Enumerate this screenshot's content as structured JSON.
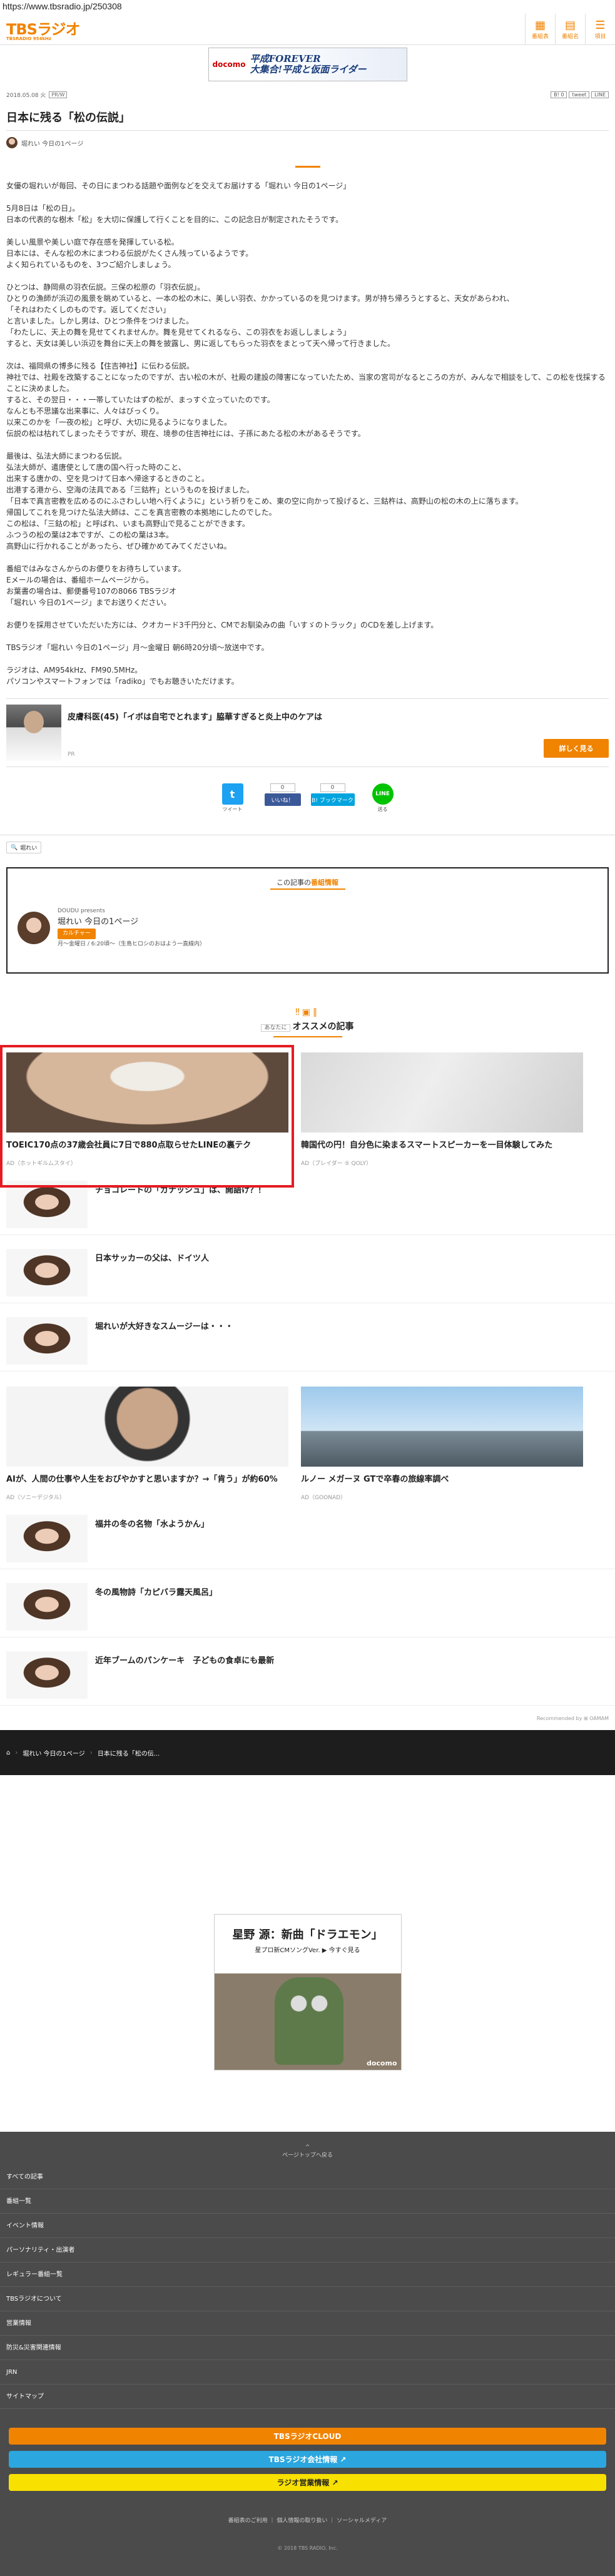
{
  "url": "https://www.tbsradio.jp/250308",
  "header": {
    "logo": "TBSラジオ",
    "logo_sub": "TBSRADIO 954kHz",
    "icons": [
      {
        "label": "番組表",
        "glyph": "▦"
      },
      {
        "label": "番組名",
        "glyph": "▤"
      },
      {
        "label": "項目",
        "glyph": "☰"
      }
    ]
  },
  "top_ad": {
    "brand": "docomo",
    "line1": "平成FOREVER",
    "line2": "大集合!平成と仮面ライダー"
  },
  "meta": {
    "date": "2018.05.08 火",
    "tag": "PR/W",
    "shares": [
      "B! 0",
      "tweet",
      "LINE"
    ]
  },
  "article": {
    "title": "日本に残る「松の伝説」",
    "program_label": "堀れい 今日の1ページ",
    "paragraphs": [
      "女優の堀れいが毎回、その日にまつわる話題や面例などを交えてお届けする「堀れい 今日の1ページ」",
      "5月8日は「松の日」。\n日本の代表的な樹木「松」を大切に保護して行くことを目的に、この記念日が制定されたそうです。",
      "美しい風景や美しい庭で存在感を発揮している松。\n日本には、そんな松の木にまつわる伝説がたくさん残っているようです。\nよく知られているものを、3つご紹介しましょう。",
      "ひとつは、静岡県の羽衣伝説。三保の松原の「羽衣伝説」。\nひとりの漁師が浜辺の風景を眺めていると、一本の松の木に、美しい羽衣、かかっているのを見つけます。男が持ち帰ろうとすると、天女があらわれ、\n「それはわたくしのものです。返してください」\nと言いました。しかし男は、ひとつ条件をつけました。\n「わたしに、天上の舞を見せてくれませんか。舞を見せてくれるなら、この羽衣をお返ししましょう」\nすると、天女は美しい浜辺を舞台に天上の舞を披露し、男に返してもらった羽衣をまとって天へ帰って行きました。",
      "次は、福岡県の博多に残る【住吉神社】に伝わる伝説。\n神社では、社殿を改築することになったのですが、古い松の木が、社殿の建設の障害になっていたため、当家の宮司がなるところの方が、みんなで相談をして、この松を伐採することに決めました。\nすると、その翌日・・・一帯していたはずの松が、まっすぐ立っていたのです。\nなんとも不思議な出来事に、人々はびっくり。\n以来このかを「一夜の松」と呼び、大切に見るようになりました。\n伝説の松は枯れてしまったそうですが、現在、境参の住吉神社には、子孫にあたる松の木があるそうです。",
      "最後は、弘法大師にまつわる伝説。\n弘法大師が、遣唐使として唐の国へ行った時のこと、\n出来する唐かの、空を見つけて日本へ帰途するときのこと。\n出港する港から、空海の法具である「三鈷杵」というものを投げました。\n「日本で真言密教を広めるのにふさわしい地へ行くように」という祈りをこめ、東の空に向かって投げると、三鈷杵は、高野山の松の木の上に落ちます。\n帰国してこれを見つけた弘法大師は、ここを真言密教の本拠地にしたのでした。\nこの松は、「三鈷の松」と呼ばれ、いまも高野山で見ることができます。\nふつうの松の葉は2本ですが、この松の葉は3本。\n高野山に行かれることがあったら、ぜひ確かめてみてくださいね。",
      "番組ではみなさんからのお便りをお待ちしています。\nEメールの場合は、番組ホームページから。\nお葉書の場合は、郵便番号107の8066 TBSラジオ\n「堀れい 今日の1ページ」までお送りください。",
      "お便りを採用させていただいた方には、クオカード3千円分と、CMでお馴染みの曲「いすゞのトラック」のCDを差し上げます。",
      "TBSラジオ「堀れい 今日の1ページ」月～金曜日 朝6時20分頃～放送中です。",
      "ラジオは、AM954kHz、FM90.5MHz。\nパソコンやスマートフォンでは「radiko」でもお聴きいただけます。"
    ]
  },
  "promo": {
    "text": "皮膚科医(45)「イボは自宅でとれます」脇華すぎると炎上中のケアは",
    "pr": "PR",
    "button": "詳しく見る"
  },
  "share": {
    "twitter": {
      "glyph": "t",
      "label": "ツイート"
    },
    "like": {
      "count": "0",
      "label": "いいね！"
    },
    "hatena": {
      "count": "0",
      "label": "B! ブックマーク"
    },
    "line": {
      "glyph": "LINE",
      "label": "送る"
    }
  },
  "program_tag": "堀れい",
  "program_info": {
    "heading_pre": "この記事の",
    "heading_main": "番組情報",
    "presents": "DOUDU presents",
    "name": "堀れい 今日の1ページ",
    "category": "カルチャー",
    "schedule": "月～金曜日 / 6:20頃～（生島ヒロシのおはよう一直線内）"
  },
  "recommend": {
    "tag": "あなたに",
    "title": "オススメの記事",
    "cards_top": [
      {
        "title": "TOEIC170点の37歳会社員に7日で880点取らせたLINEの裏テク",
        "src": "AD（ホットギルムスタイ）",
        "img": "smile"
      },
      {
        "title": "韓国代の円！自分色に染まるスマートスピーカーを一目体験してみた",
        "src": "AD（ブレイダー ⑤ QOLY）",
        "img": "speaker"
      }
    ],
    "list_a": [
      {
        "title": "チョコレートの「ガナッシュ」は、開語け？！"
      },
      {
        "title": "日本サッカーの父は、ドイツ人"
      },
      {
        "title": "堀れいが大好きなスムージーは・・・"
      }
    ],
    "cards_mid": [
      {
        "title": "AIが、人間の仕事や人生をおびやかすと思いますか？→「肯う」が約60%",
        "src": "AD（ソニーデジタル）",
        "img": "man"
      },
      {
        "title": "ルノー メガーヌ GTで卒春の旅線率調べ",
        "src": "AD（GOONAD）",
        "img": "car"
      }
    ],
    "list_b": [
      {
        "title": "福井の冬の名物「水ようかん」"
      },
      {
        "title": "冬の風物詩「カピバラ露天風呂」"
      },
      {
        "title": "近年ブームのパンケーキ　子どもの食卓にも最新"
      }
    ],
    "by": "Recommended by ⊞ OAMAM"
  },
  "breadcrumb": [
    "⌂",
    "堀れい 今日の1ページ",
    "日本に残る「松の伝..."
  ],
  "mid_ad": {
    "line1": "星野 源：新曲「ドラエモン」",
    "line2": "星プロ新CMソングVer. ▶ 今すぐ見る",
    "brand": "docomo"
  },
  "footer": {
    "pagetop": "^\nページトップへ戻る",
    "nav": [
      "すべての記事",
      "番組一覧",
      "イベント情報",
      "パーソナリティ・出演者",
      "レギュラー番組一覧",
      "TBSラジオについて",
      "営業情報",
      "防災&災害関連情報",
      "JRN",
      "サイトマップ"
    ],
    "buttons": [
      "TBSラジオCLOUD",
      "TBSラジオ会社情報 ↗",
      "ラジオ営業情報 ↗"
    ],
    "links": "番組表のご利用 ｜ 個人情報の取り扱い ｜ ソーシャルメディア",
    "copyright": "© 2018 TBS RADIO, Inc."
  }
}
